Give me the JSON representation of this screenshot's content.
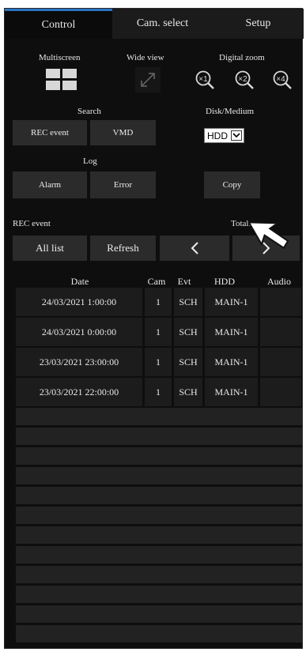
{
  "tabs": [
    "Control",
    "Cam. select",
    "Setup"
  ],
  "multiscreen": {
    "label": "Multiscreen"
  },
  "wide_view": {
    "label": "Wide view"
  },
  "digital_zoom": {
    "label": "Digital zoom",
    "levels": [
      "x1",
      "x2",
      "x4"
    ]
  },
  "search": {
    "label": "Search",
    "rec_event": "REC event",
    "vmd": "VMD"
  },
  "disk": {
    "label": "Disk/Medium",
    "selected": "HDD"
  },
  "log": {
    "label": "Log",
    "alarm": "Alarm",
    "error": "Error"
  },
  "copy": "Copy",
  "rec_event": {
    "label": "REC event",
    "total_label": "Total:",
    "all_list": "All list",
    "refresh": "Refresh",
    "prev": "<",
    "next": ">"
  },
  "table": {
    "columns": [
      "Date",
      "Cam",
      "Evt",
      "HDD",
      "Audio"
    ],
    "rows": [
      {
        "date": "24/03/2021  1:00:00",
        "cam": "1",
        "evt": "SCH",
        "hdd": "MAIN-1",
        "audio": ""
      },
      {
        "date": "24/03/2021  0:00:00",
        "cam": "1",
        "evt": "SCH",
        "hdd": "MAIN-1",
        "audio": ""
      },
      {
        "date": "23/03/2021  23:00:00",
        "cam": "1",
        "evt": "SCH",
        "hdd": "MAIN-1",
        "audio": ""
      },
      {
        "date": "23/03/2021  22:00:00",
        "cam": "1",
        "evt": "SCH",
        "hdd": "MAIN-1",
        "audio": ""
      }
    ]
  },
  "colors": {
    "panel": "#0e0e0e",
    "button": "#2b2b2b",
    "cell": "#1c1c1c",
    "tab_accent": "#2a73c6"
  },
  "icons": [
    "multiscreen-grid-icon",
    "wide-view-expand-icon",
    "zoom-x1-icon",
    "zoom-x2-icon",
    "zoom-x4-icon",
    "chevron-left-icon",
    "chevron-right-icon",
    "mouse-pointer-icon"
  ]
}
